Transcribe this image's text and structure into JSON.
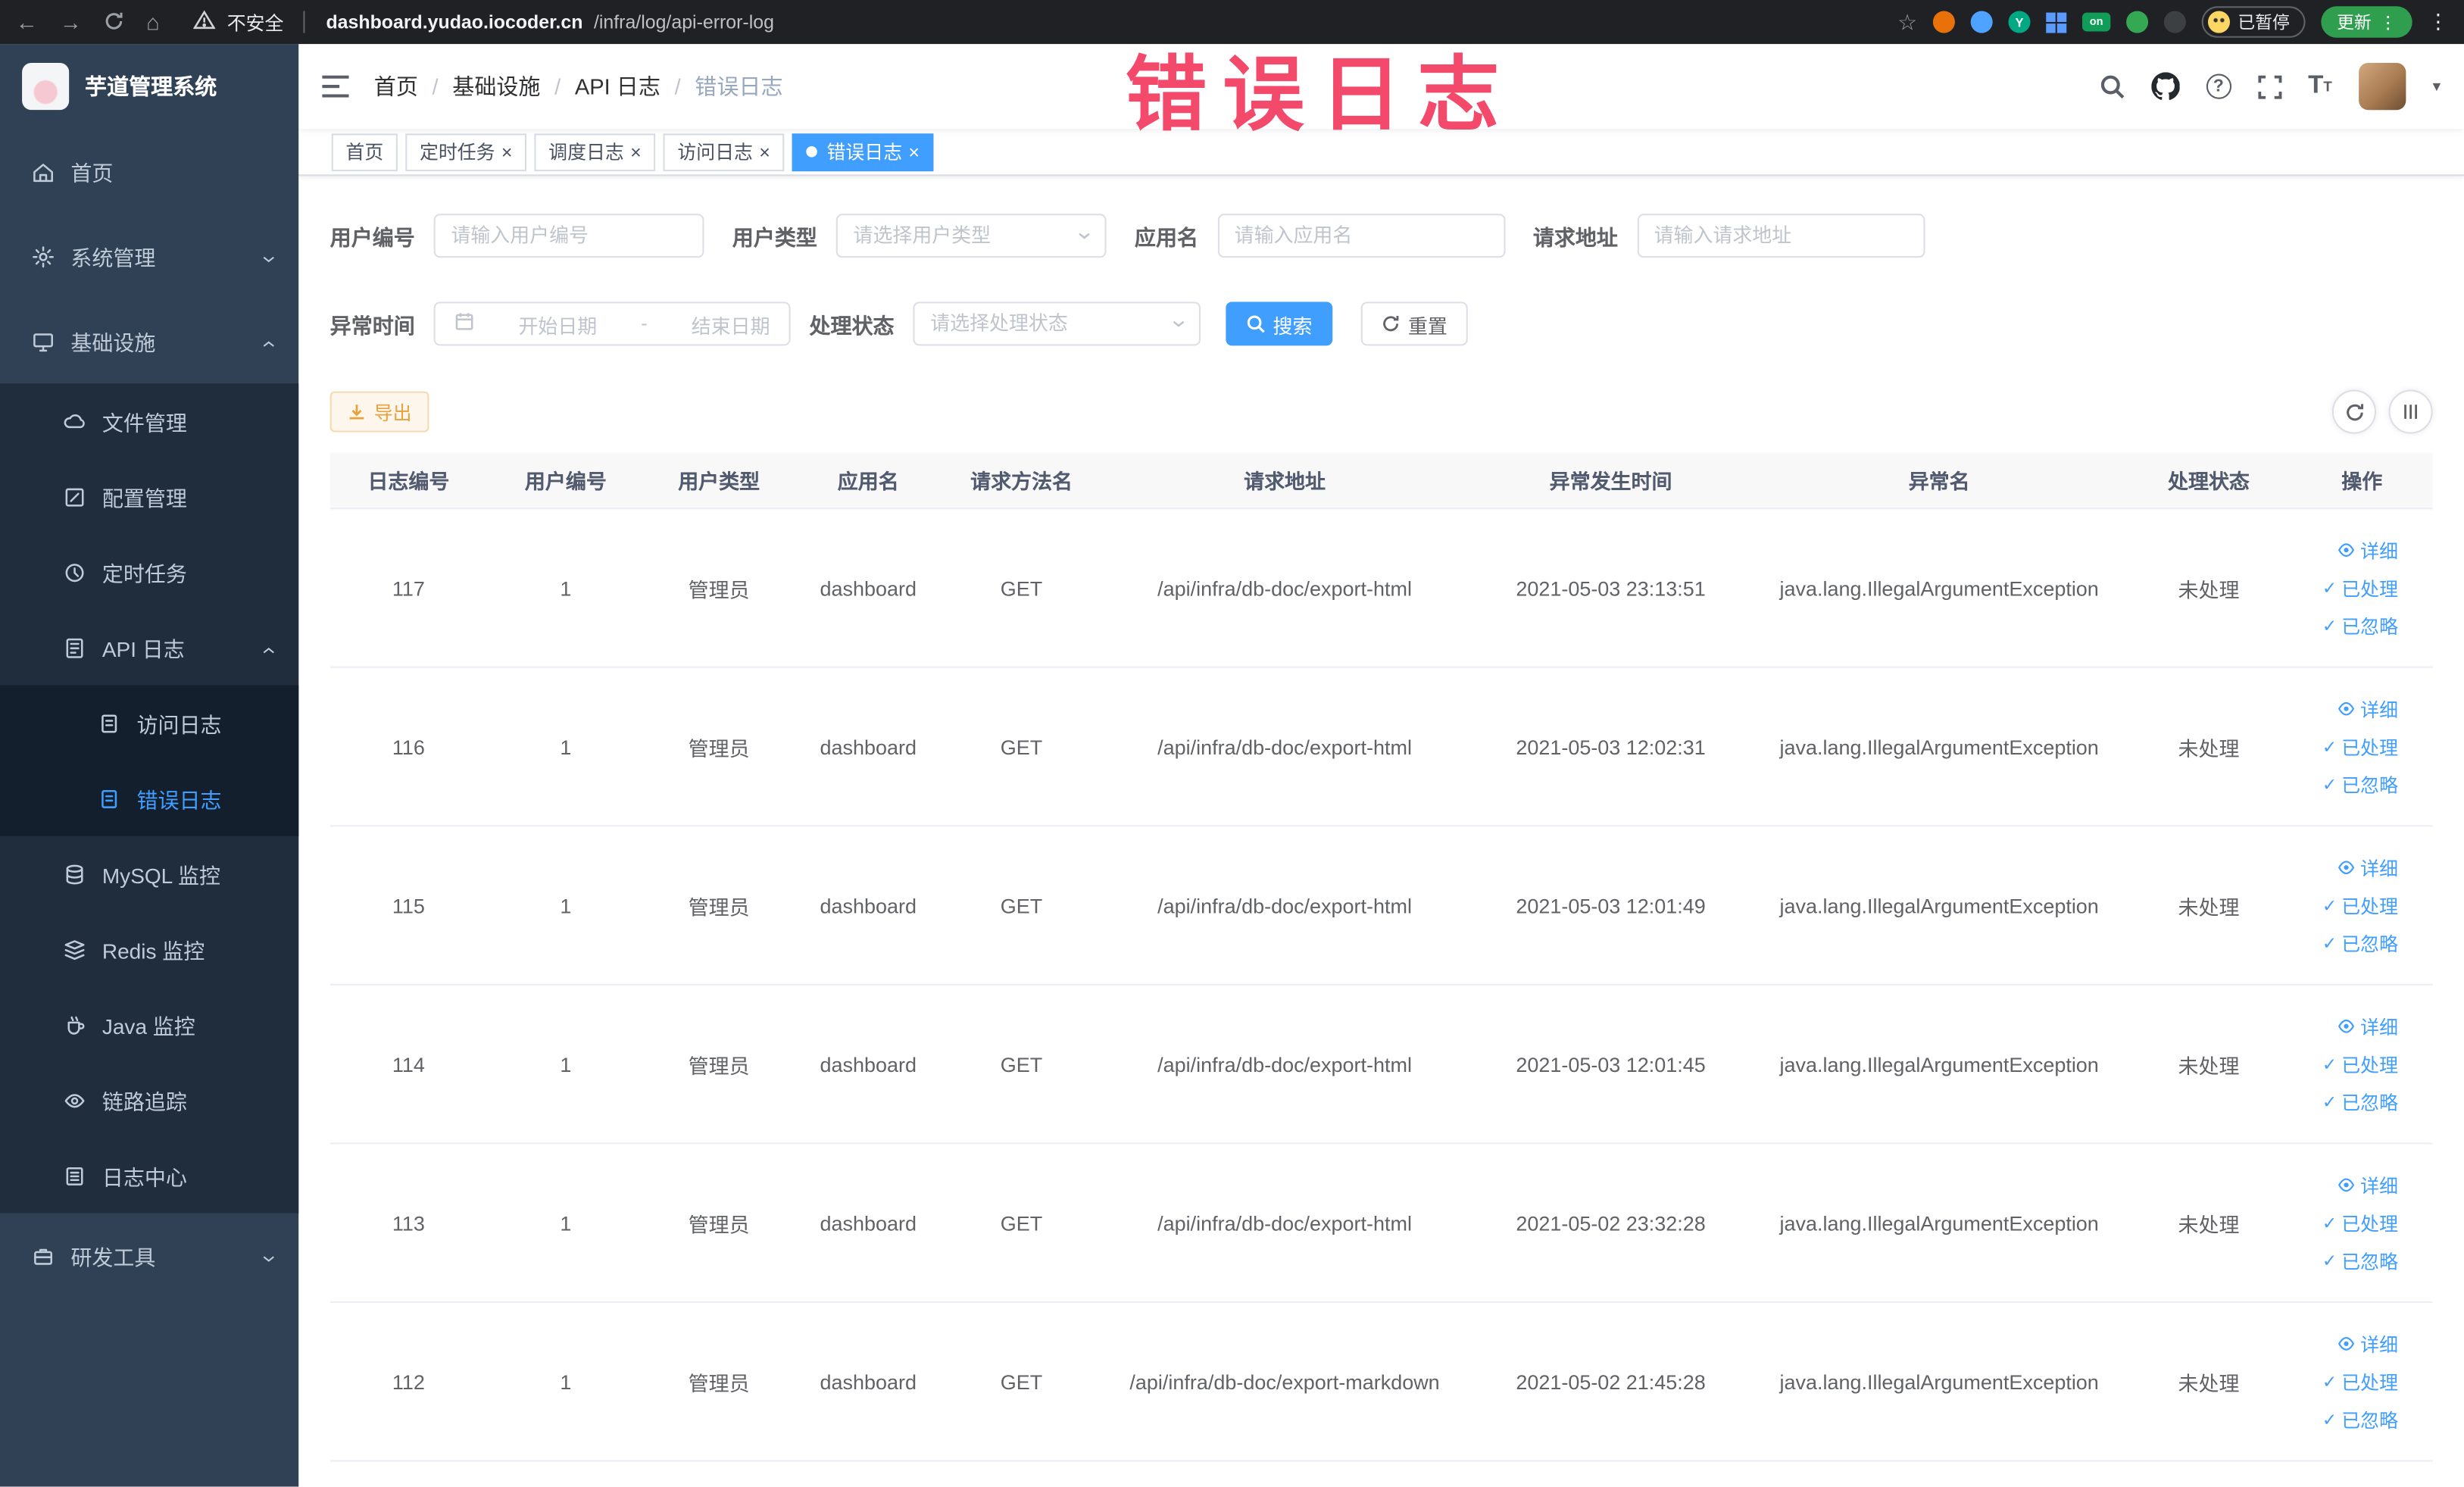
{
  "browser": {
    "security_label": "不安全",
    "url_host": "dashboard.yudao.iocoder.cn",
    "url_path": "/infra/log/api-error-log",
    "paused_label": "已暂停",
    "update_label": "更新"
  },
  "watermark": "错误日志",
  "sidebar": {
    "logo_title": "芋道管理系统",
    "items": [
      {
        "label": "首页"
      },
      {
        "label": "系统管理"
      },
      {
        "label": "基础设施"
      },
      {
        "label": "文件管理"
      },
      {
        "label": "配置管理"
      },
      {
        "label": "定时任务"
      },
      {
        "label": "API 日志"
      },
      {
        "label": "访问日志"
      },
      {
        "label": "错误日志"
      },
      {
        "label": "MySQL 监控"
      },
      {
        "label": "Redis 监控"
      },
      {
        "label": "Java 监控"
      },
      {
        "label": "链路追踪"
      },
      {
        "label": "日志中心"
      },
      {
        "label": "研发工具"
      }
    ]
  },
  "breadcrumb": [
    "首页",
    "基础设施",
    "API 日志",
    "错误日志"
  ],
  "tabs": [
    {
      "label": "首页"
    },
    {
      "label": "定时任务"
    },
    {
      "label": "调度日志"
    },
    {
      "label": "访问日志"
    },
    {
      "label": "错误日志"
    }
  ],
  "filters": {
    "user_id_label": "用户编号",
    "user_id_placeholder": "请输入用户编号",
    "user_type_label": "用户类型",
    "user_type_placeholder": "请选择用户类型",
    "app_name_label": "应用名",
    "app_name_placeholder": "请输入应用名",
    "request_url_label": "请求地址",
    "request_url_placeholder": "请输入请求地址",
    "exception_time_label": "异常时间",
    "date_start_placeholder": "开始日期",
    "date_separator": "-",
    "date_end_placeholder": "结束日期",
    "process_status_label": "处理状态",
    "process_status_placeholder": "请选择处理状态",
    "search_button": "搜索",
    "reset_button": "重置"
  },
  "toolbar": {
    "export_button": "导出"
  },
  "table": {
    "columns": [
      "日志编号",
      "用户编号",
      "用户类型",
      "应用名",
      "请求方法名",
      "请求地址",
      "异常发生时间",
      "异常名",
      "处理状态",
      "操作"
    ],
    "action_labels": {
      "detail": "详细",
      "processed": "已处理",
      "ignored": "已忽略"
    },
    "rows": [
      {
        "id": "117",
        "user_id": "1",
        "user_type": "管理员",
        "app": "dashboard",
        "method": "GET",
        "url": "/api/infra/db-doc/export-html",
        "time": "2021-05-03 23:13:51",
        "exception": "java.lang.IllegalArgumentException",
        "status": "未处理"
      },
      {
        "id": "116",
        "user_id": "1",
        "user_type": "管理员",
        "app": "dashboard",
        "method": "GET",
        "url": "/api/infra/db-doc/export-html",
        "time": "2021-05-03 12:02:31",
        "exception": "java.lang.IllegalArgumentException",
        "status": "未处理"
      },
      {
        "id": "115",
        "user_id": "1",
        "user_type": "管理员",
        "app": "dashboard",
        "method": "GET",
        "url": "/api/infra/db-doc/export-html",
        "time": "2021-05-03 12:01:49",
        "exception": "java.lang.IllegalArgumentException",
        "status": "未处理"
      },
      {
        "id": "114",
        "user_id": "1",
        "user_type": "管理员",
        "app": "dashboard",
        "method": "GET",
        "url": "/api/infra/db-doc/export-html",
        "time": "2021-05-03 12:01:45",
        "exception": "java.lang.IllegalArgumentException",
        "status": "未处理"
      },
      {
        "id": "113",
        "user_id": "1",
        "user_type": "管理员",
        "app": "dashboard",
        "method": "GET",
        "url": "/api/infra/db-doc/export-html",
        "time": "2021-05-02 23:32:28",
        "exception": "java.lang.IllegalArgumentException",
        "status": "未处理"
      },
      {
        "id": "112",
        "user_id": "1",
        "user_type": "管理员",
        "app": "dashboard",
        "method": "GET",
        "url": "/api/infra/db-doc/export-markdown",
        "time": "2021-05-02 21:45:28",
        "exception": "java.lang.IllegalArgumentException",
        "status": "未处理"
      }
    ]
  },
  "colors": {
    "primary": "#409eff",
    "sidebar_bg": "#304156",
    "warning": "#e6a23c",
    "watermark": "#f23a5f",
    "active_tab_bg": "#409eff"
  }
}
